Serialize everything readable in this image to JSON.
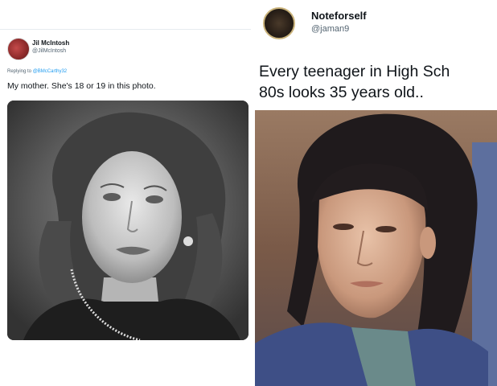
{
  "left_tweet": {
    "author_name": "Jil McIntosh",
    "author_handle": "@JilMcIntosh",
    "reply_prefix": "Replying to ",
    "reply_to": "@BMcCarthy32",
    "text": "My mother. She's 18 or 19 in this photo."
  },
  "right_tweet": {
    "author_name": "Noteforself",
    "author_handle": "@jaman9",
    "text_line1": "Every teenager in High Sch",
    "text_line2": "80s looks 35 years old.."
  },
  "colors": {
    "text_primary": "#0f1419",
    "text_secondary": "#536471",
    "mention_blue": "#1d9bf0"
  },
  "icons": [
    "avatar-jil",
    "avatar-noteforself"
  ]
}
